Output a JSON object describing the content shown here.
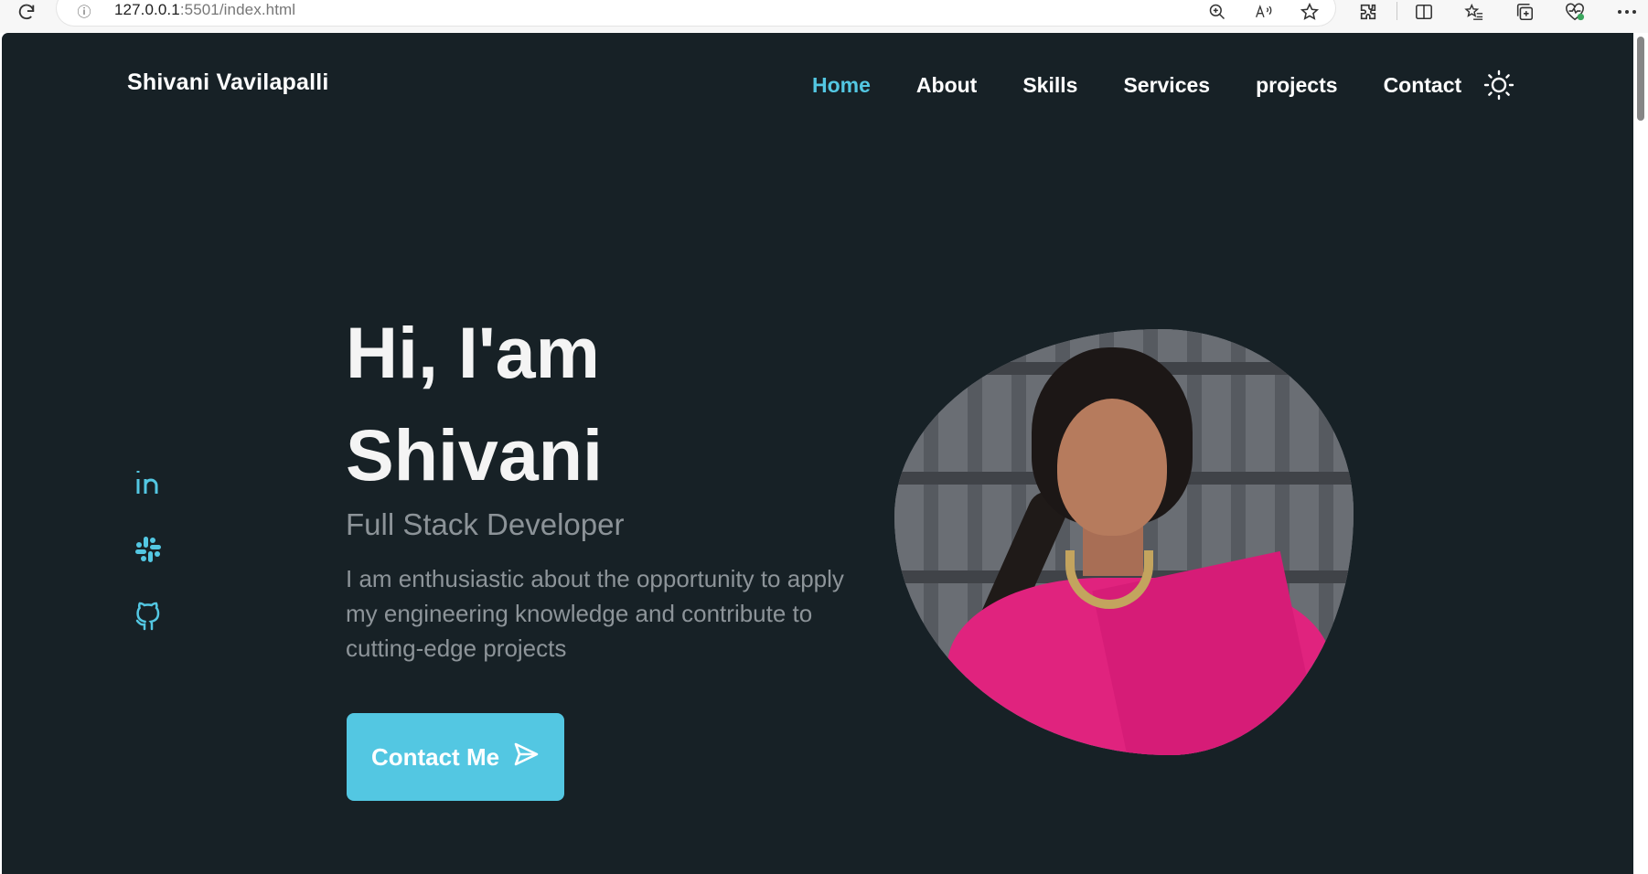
{
  "browser": {
    "url_host": "127.0.0.1",
    "url_port_path": ":5501/index.html",
    "toolbar_icons": [
      "reload-icon",
      "site-info-icon",
      "zoom-icon",
      "read-aloud-icon",
      "favorite-star-icon",
      "extensions-icon",
      "split-screen-icon",
      "favorites-icon",
      "collections-icon",
      "performance-icon",
      "more-icon"
    ]
  },
  "header": {
    "brand": "Shivani Vavilapalli",
    "nav": [
      {
        "label": "Home",
        "active": true
      },
      {
        "label": "About",
        "active": false
      },
      {
        "label": "Skills",
        "active": false
      },
      {
        "label": "Services",
        "active": false
      },
      {
        "label": "projects",
        "active": false
      },
      {
        "label": "Contact",
        "active": false
      }
    ],
    "theme_icon": "sun-icon"
  },
  "hero": {
    "greeting": "Hi, I'am",
    "name": "Shivani",
    "role": "Full Stack Developer",
    "description": "I am enthusiastic about the opportunity to apply my engineering knowledge and contribute to cutting-edge projects",
    "cta_label": "Contact Me",
    "cta_icon": "send-icon"
  },
  "social": [
    {
      "icon": "linkedin-icon"
    },
    {
      "icon": "slack-icon"
    },
    {
      "icon": "github-icon"
    }
  ],
  "colors": {
    "background": "#172126",
    "accent": "#53c7e2",
    "text": "#ffffff",
    "muted": "#8d9499"
  }
}
